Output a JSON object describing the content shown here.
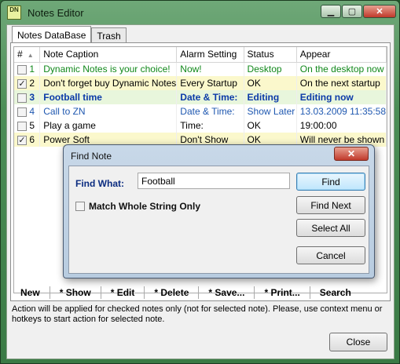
{
  "window": {
    "title": "Notes Editor",
    "icon_text": "DN",
    "buttons": [
      "minimize-icon",
      "maximize-icon",
      "close-icon"
    ]
  },
  "tabs": [
    {
      "label": "Notes DataBase",
      "active": true
    },
    {
      "label": "Trash",
      "active": false
    }
  ],
  "table": {
    "headers": [
      "#",
      "Note Caption",
      "Alarm Setting",
      "Status",
      "Appear"
    ],
    "rows": [
      {
        "checked": false,
        "num": "1",
        "caption": "Dynamic Notes is your choice!",
        "alarm": "Now!",
        "status": "Desktop",
        "appear": "On the desktop now"
      },
      {
        "checked": true,
        "num": "2",
        "caption": "Don't forget buy Dynamic Notes",
        "alarm": "Every Startup",
        "status": "OK",
        "appear": "On the next startup"
      },
      {
        "checked": false,
        "num": "3",
        "caption": "Football time",
        "alarm": "Date & Time:",
        "status": "Editing",
        "appear": "Editing now"
      },
      {
        "checked": false,
        "num": "4",
        "caption": "Call to ZN",
        "alarm": "Date & Time:",
        "status": "Show Later",
        "appear": "13.03.2009 11:35:58"
      },
      {
        "checked": false,
        "num": "5",
        "caption": "Play a game",
        "alarm": "Time:",
        "status": "OK",
        "appear": "19:00:00"
      },
      {
        "checked": true,
        "num": "6",
        "caption": "Power Soft",
        "alarm": "Don't Show",
        "status": "OK",
        "appear": "Will never be shown"
      }
    ]
  },
  "toolbar": {
    "new": "New",
    "show": "* Show",
    "edit": "* Edit",
    "delete": "* Delete",
    "save": "* Save...",
    "print": "* Print...",
    "search": "Search"
  },
  "help_text": "Action will be applied for checked notes only (not for selected note). Please, use context menu or hotkeys to start action for selected note.",
  "close_label": "Close",
  "dialog": {
    "title": "Find Note",
    "close_icon": "close-icon",
    "find_label": "Find What:",
    "find_value": "Football",
    "match_label": "Match Whole String Only",
    "match_checked": false,
    "find_button": "Find",
    "find_next_button": "Find Next",
    "select_all_button": "Select All",
    "cancel_button": "Cancel"
  },
  "colors": {
    "accent_green": "#10881a",
    "accent_blue": "#0b3aa8",
    "highlight_yellow": "#fbf8cc"
  }
}
